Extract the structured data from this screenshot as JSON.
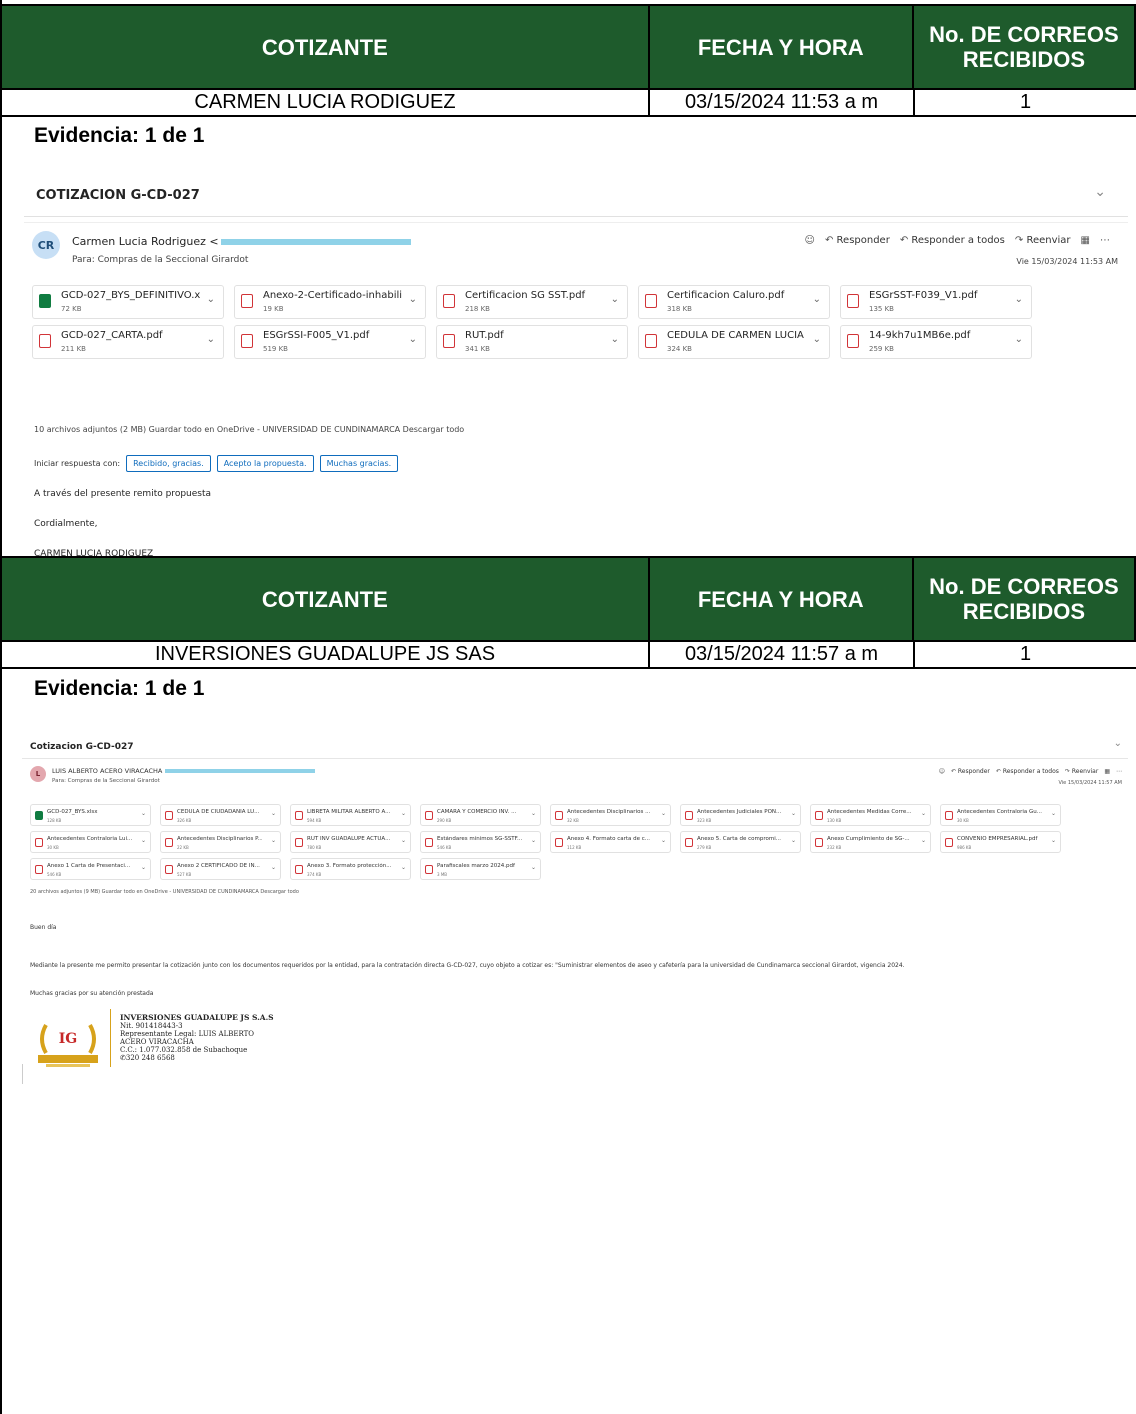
{
  "header": {
    "col1": "COTIZANTE",
    "col2": "FECHA Y HORA",
    "col3": "No. DE CORREOS RECIBIDOS"
  },
  "entries": [
    {
      "cotizante": "CARMEN LUCIA RODIGUEZ",
      "fecha": "03/15/2024  11:53 a m",
      "correos": "1",
      "evidencia": "Evidencia: 1 de 1"
    },
    {
      "cotizante": "INVERSIONES GUADALUPE  JS SAS",
      "fecha": "03/15/2024  11:57 a m",
      "correos": "1",
      "evidencia": "Evidencia: 1 de 1"
    }
  ],
  "email1": {
    "subject": "COTIZACION G-CD-027",
    "avatar": "CR",
    "sender": "Carmen Lucia Rodriguez <",
    "to": "Para:  Compras de la Seccional Girardot",
    "actions": {
      "reply": "Responder",
      "reply_all": "Responder a todos",
      "forward": "Reenviar"
    },
    "date": "Vie 15/03/2024 11:53 AM",
    "attachments": [
      {
        "name": "GCD-027_BYS_DEFINITIVO.xlsx",
        "size": "72 KB",
        "type": "xlsx"
      },
      {
        "name": "Anexo-2-Certificado-inhabili...",
        "size": "19 KB",
        "type": "pdf"
      },
      {
        "name": "Certificacion SG SST.pdf",
        "size": "218 KB",
        "type": "pdf"
      },
      {
        "name": "Certificacion Caluro.pdf",
        "size": "318 KB",
        "type": "pdf"
      },
      {
        "name": "ESGrSST-F039_V1.pdf",
        "size": "135 KB",
        "type": "pdf"
      },
      {
        "name": "GCD-027_CARTA.pdf",
        "size": "211 KB",
        "type": "pdf"
      },
      {
        "name": "ESGrSSI-F005_V1.pdf",
        "size": "519 KB",
        "type": "pdf"
      },
      {
        "name": "RUT.pdf",
        "size": "341 KB",
        "type": "pdf"
      },
      {
        "name": "CEDULA DE CARMEN LUCIA ...",
        "size": "324 KB",
        "type": "pdf"
      },
      {
        "name": "14-9kh7u1MB6e.pdf",
        "size": "259 KB",
        "type": "pdf"
      }
    ],
    "info": "10 archivos adjuntos (2 MB)     Guardar todo en OneDrive - UNIVERSIDAD DE CUNDINAMARCA      Descargar todo",
    "quick_label": "Iniciar respuesta con:",
    "quick": [
      "Recibido, gracias.",
      "Acepto la propuesta.",
      "Muchas gracias."
    ],
    "body": [
      "A través del presente remito propuesta",
      "Cordialmente,",
      "CARMEN LUCIA RODIGUEZ"
    ]
  },
  "email2": {
    "subject": "Cotizacion G-CD-027",
    "avatar": "L",
    "sender": "LUIS ALBERTO ACERO VIRACACHA",
    "to": "Para:  Compras de la Seccional Girardot",
    "actions": {
      "reply": "Responder",
      "reply_all": "Responder a todos",
      "forward": "Reenviar"
    },
    "date": "Vie 15/03/2024 11:57 AM",
    "attachments": [
      {
        "name": "GCD-027_BYS.xlsx",
        "size": "128 KB",
        "type": "xlsx"
      },
      {
        "name": "CEDULA DE CIUDADANIA LU...",
        "size": "326 KB",
        "type": "pdf"
      },
      {
        "name": "LIBRETA MILITAR ALBERTO A...",
        "size": "594 KB",
        "type": "pdf"
      },
      {
        "name": "CAMARA Y COMERCIO INV. ...",
        "size": "290 KB",
        "type": "pdf"
      },
      {
        "name": "Antecedentes Disciplinarios ...",
        "size": "32 KB",
        "type": "pdf"
      },
      {
        "name": "Antecedentes Judiciales PON...",
        "size": "323 KB",
        "type": "pdf"
      },
      {
        "name": "Antecedentes Medidas Corre...",
        "size": "130 KB",
        "type": "pdf"
      },
      {
        "name": "Antecedentes Contraloria Gu...",
        "size": "30 KB",
        "type": "pdf"
      },
      {
        "name": "Antecedentes Contraloria Lui...",
        "size": "30 KB",
        "type": "pdf"
      },
      {
        "name": "Antecedentes Disciplinarios P...",
        "size": "22 KB",
        "type": "pdf"
      },
      {
        "name": "RUT INV GUADALUPE ACTUA...",
        "size": "780 KB",
        "type": "pdf"
      },
      {
        "name": "Estándares mínimos SG-SSTF...",
        "size": "546 KB",
        "type": "pdf"
      },
      {
        "name": "Anexo 4. Formato carta de c...",
        "size": "112 KB",
        "type": "pdf"
      },
      {
        "name": "Anexo 5. Carta de compromi...",
        "size": "279 KB",
        "type": "pdf"
      },
      {
        "name": "Anexo Cumplimiento de SG-...",
        "size": "232 KB",
        "type": "pdf"
      },
      {
        "name": "CONVENIO EMPRESARIAL.pdf",
        "size": "986 KB",
        "type": "pdf"
      },
      {
        "name": "Anexo 1 Carta de Presentaci...",
        "size": "546 KB",
        "type": "pdf"
      },
      {
        "name": "Anexo 2 CERTIFICADO DE IN...",
        "size": "527 KB",
        "type": "pdf"
      },
      {
        "name": "Anexo 3. Formato protección...",
        "size": "374 KB",
        "type": "pdf"
      },
      {
        "name": "Parafiscales marzo 2024.pdf",
        "size": "3 MB",
        "type": "pdf"
      }
    ],
    "info": "20 archivos adjuntos (9 MB)     Guardar todo en OneDrive - UNIVERSIDAD DE CUNDINAMARCA      Descargar todo",
    "body": [
      "Buen día",
      "Mediante la presente me permito presentar la cotización junto con los documentos requeridos por la entidad, para la contratación directa G-CD-027, cuyo objeto a cotizar es: \"Suministrar elementos de aseo y cafetería para la universidad de Cundinamarca seccional Girardot, vigencia 2024.",
      "Muchas gracias por su atención prestada"
    ],
    "logo_text": "IG",
    "signature": [
      "INVERSIONES GUADALUPE JS S.A.S",
      "Nit. 901418443-3",
      "Representante Legal: LUIS ALBERTO",
      "ACERO VIRACACHA",
      "C.C.: 1.077.032.858 de Subachoque",
      "320 248 6568"
    ]
  },
  "colors": {
    "header_bg": "#1e5b2c",
    "link": "#0f6cbd",
    "mask": "#8fd2e8",
    "pdf": "#d13438",
    "xlsx": "#107c41",
    "gold": "#d7a21b"
  }
}
